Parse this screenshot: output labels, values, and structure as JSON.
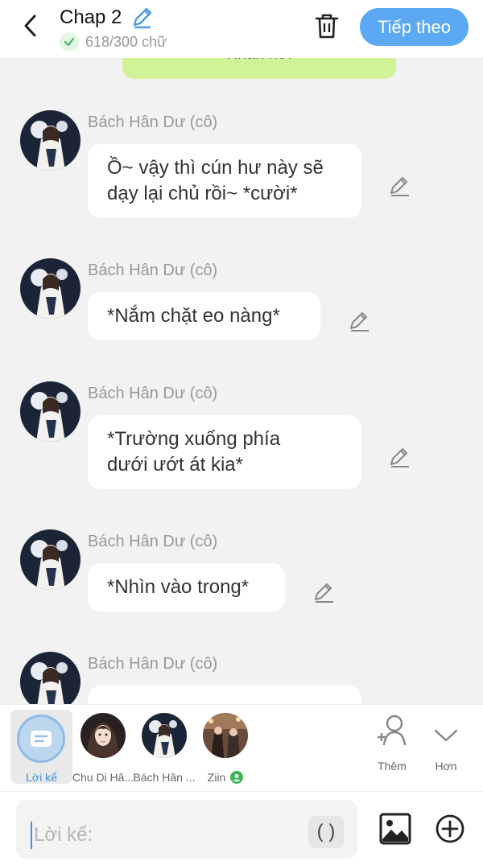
{
  "header": {
    "title": "Chap 2",
    "word_count": "618/300 chữ",
    "next_label": "Tiếp theo"
  },
  "narration_bubble_text": "Khẩn nơi",
  "messages": [
    {
      "sender": "Bách Hân Dư (cô)",
      "text": "Ồ~ vậy thì cún hư này sẽ\ndạy lại chủ rồi~ *cười*"
    },
    {
      "sender": "Bách Hân Dư (cô)",
      "text": "*Nắm chặt eo nàng*"
    },
    {
      "sender": "Bách Hân Dư (cô)",
      "text": "*Trường xuống phía\ndưới ướt át kia*"
    },
    {
      "sender": "Bách Hân Dư (cô)",
      "text": "*Nhìn vào trong*"
    },
    {
      "sender": "Bách Hân Dư (cô)",
      "text": ""
    }
  ],
  "characters": {
    "narrator_label": "Lời kể",
    "list": [
      {
        "name": "Chu Di Hâ..."
      },
      {
        "name": "Bách Hân ..."
      },
      {
        "name": "Ziin"
      }
    ],
    "add_label": "Thêm",
    "more_label": "Hơn"
  },
  "input": {
    "placeholder": "Lời kể:",
    "paren_label": "( )"
  },
  "colors": {
    "accent": "#5aa9f2",
    "narration_bubble": "#d2f29a",
    "check_green": "#3cb55a"
  }
}
